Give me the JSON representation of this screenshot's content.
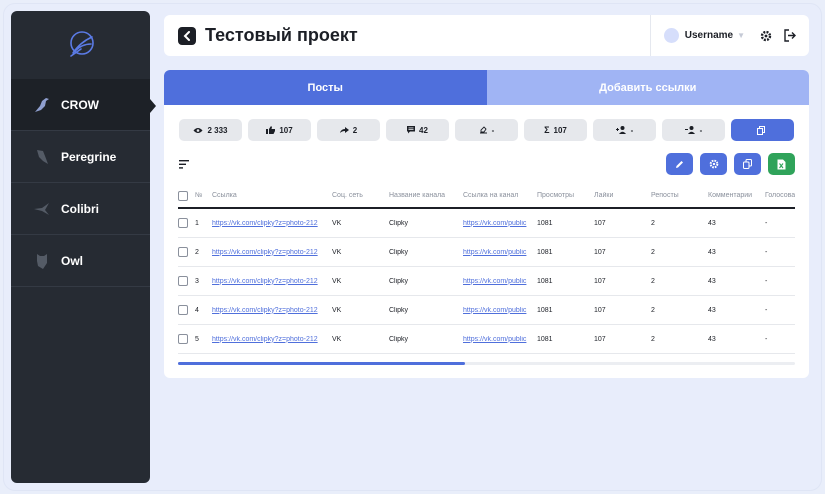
{
  "sidebar": {
    "items": [
      {
        "label": "CROW",
        "icon": "crow-icon",
        "active": true
      },
      {
        "label": "Peregrine",
        "icon": "peregrine-icon",
        "active": false
      },
      {
        "label": "Colibri",
        "icon": "colibri-icon",
        "active": false
      },
      {
        "label": "Owl",
        "icon": "owl-icon",
        "active": false
      }
    ]
  },
  "header": {
    "title": "Тестовый проект",
    "username": "Username"
  },
  "tabs": [
    {
      "label": "Посты",
      "active": true
    },
    {
      "label": "Добавить ссылки",
      "active": false
    }
  ],
  "stats": [
    {
      "icon": "eye-icon",
      "value": "2 333"
    },
    {
      "icon": "thumbs-up-icon",
      "value": "107"
    },
    {
      "icon": "share-icon",
      "value": "2"
    },
    {
      "icon": "comment-icon",
      "value": "42"
    },
    {
      "icon": "vote-icon",
      "value": "-"
    },
    {
      "icon": "sum-icon",
      "value": "107"
    },
    {
      "icon": "add-user-icon",
      "value": "-"
    },
    {
      "icon": "remove-user-icon",
      "value": "-"
    },
    {
      "icon": "copy-icon",
      "value": ""
    }
  ],
  "table": {
    "columns": [
      "№",
      "Ссылка",
      "Соц. сеть",
      "Название канала",
      "Ссылка на канал",
      "Просмотры",
      "Лайки",
      "Репосты",
      "Комментарии",
      "Голосова"
    ],
    "rows": [
      [
        "1",
        "https://vk.com/clipky?z=photo-212",
        "VK",
        "Clipky",
        "https://vk.com/public",
        "1081",
        "107",
        "2",
        "43",
        "-"
      ],
      [
        "2",
        "https://vk.com/clipky?z=photo-212",
        "VK",
        "Clipky",
        "https://vk.com/public",
        "1081",
        "107",
        "2",
        "43",
        "-"
      ],
      [
        "3",
        "https://vk.com/clipky?z=photo-212",
        "VK",
        "Clipky",
        "https://vk.com/public",
        "1081",
        "107",
        "2",
        "43",
        "-"
      ],
      [
        "4",
        "https://vk.com/clipky?z=photo-212",
        "VK",
        "Clipky",
        "https://vk.com/public",
        "1081",
        "107",
        "2",
        "43",
        "-"
      ],
      [
        "5",
        "https://vk.com/clipky?z=photo-212",
        "VK",
        "Clipky",
        "https://vk.com/public",
        "1081",
        "107",
        "2",
        "43",
        "-"
      ]
    ]
  },
  "scroll": {
    "position": 0.47
  },
  "colors": {
    "accent": "#4f6fdc",
    "accent_light": "#a0b4f4",
    "sidebar": "#262b33",
    "excel": "#2fa35a"
  }
}
